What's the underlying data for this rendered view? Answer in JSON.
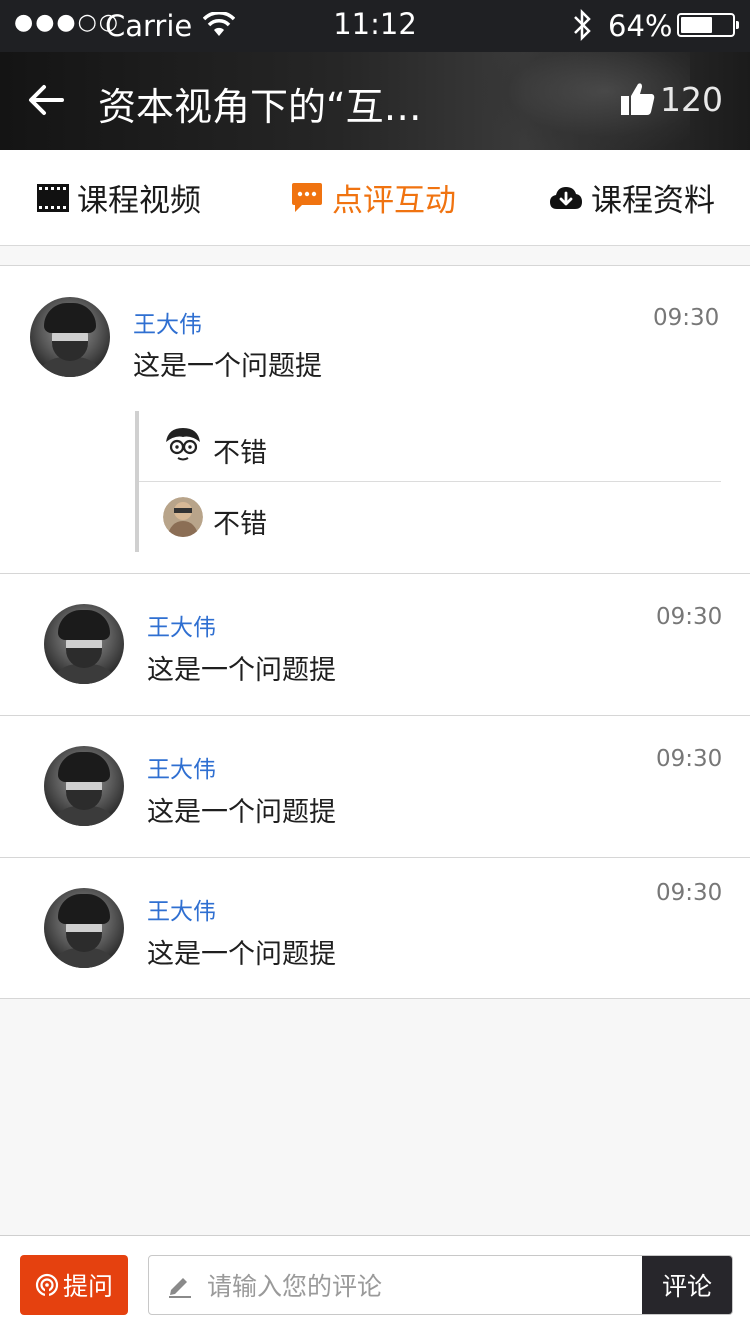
{
  "status_bar": {
    "signal": "●●●○○",
    "carrier": "Carrie",
    "time": "11:12",
    "battery": "64%",
    "battery_level": 0.64
  },
  "navbar": {
    "title": "资本视角下的“互…",
    "like_count": "120"
  },
  "tabs": [
    {
      "label": "课程视频",
      "icon": "film-icon",
      "active": false
    },
    {
      "label": "点评互动",
      "icon": "comment-icon",
      "active": true
    },
    {
      "label": "课程资料",
      "icon": "cloud-download-icon",
      "active": false
    }
  ],
  "comments": [
    {
      "name": "王大伟",
      "time": "09:30",
      "text": "这是一个问题提",
      "replies": [
        {
          "text": "不错"
        },
        {
          "text": "不错"
        }
      ]
    },
    {
      "name": "王大伟",
      "time": "09:30",
      "text": "这是一个问题提"
    },
    {
      "name": "王大伟",
      "time": "09:30",
      "text": "这是一个问题提"
    },
    {
      "name": "王大伟",
      "time": "09:30",
      "text": "这是一个问题提"
    }
  ],
  "bottom_bar": {
    "ask_label": "提问",
    "comment_placeholder": "请输入您的评论",
    "submit_label": "评论"
  },
  "colors": {
    "accent": "#f07310",
    "ask_button": "#e5410f",
    "username": "#2f6fd1",
    "header_bg": "#1f2023"
  }
}
